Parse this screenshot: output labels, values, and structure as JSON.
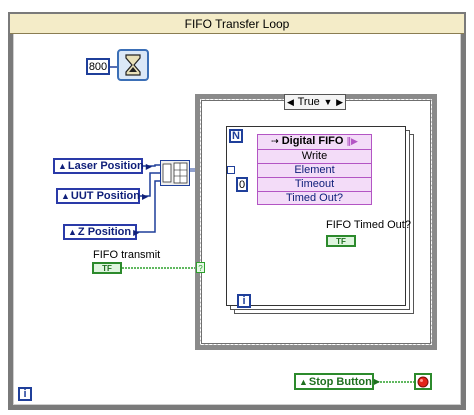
{
  "loop": {
    "title": "FIFO Transfer Loop",
    "iteration_symbol": "i"
  },
  "wait": {
    "value": "800"
  },
  "controls": {
    "laser_position": "Laser Position",
    "uut_position": "UUT Position",
    "z_position": "Z Position",
    "stop_button": "Stop Button"
  },
  "case": {
    "selector_value": "True"
  },
  "for_loop": {
    "count_symbol": "N",
    "iteration_symbol": "i"
  },
  "fifo": {
    "title": "Digital FIFO",
    "method": "Write",
    "element": "Element",
    "timeout": "Timeout",
    "timed_out": "Timed Out?",
    "timeout_const": "0"
  },
  "indicators": {
    "fifo_timed_out_label": "FIFO Timed Out?",
    "fifo_transmit_label": "FIFO transmit",
    "bool_glyph": "TF"
  },
  "colors": {
    "numeric_wire": "#ff7e00",
    "boolean_wire": "#2ca02c",
    "cluster_wire": "#1f3f9a",
    "stop_led": "#e2231a"
  }
}
